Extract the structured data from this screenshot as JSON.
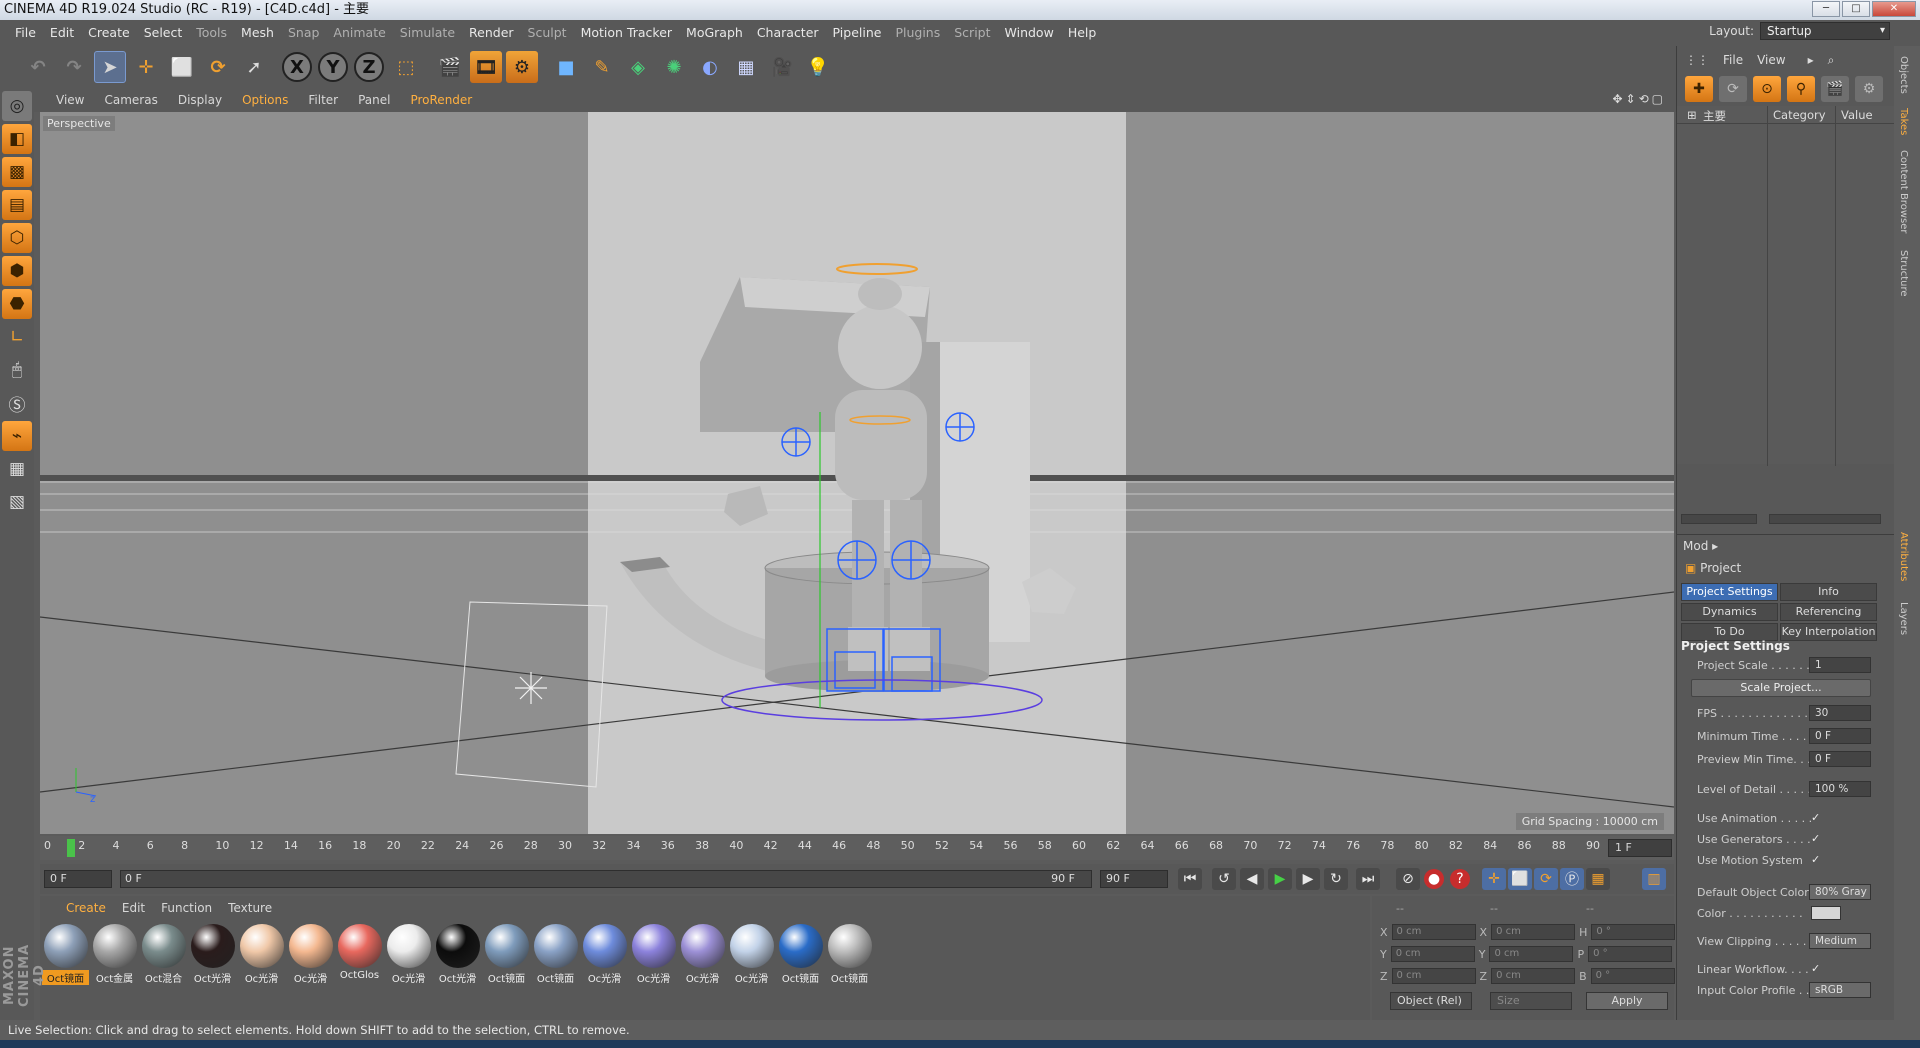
{
  "window": {
    "title": "CINEMA 4D R19.024 Studio (RC - R19) - [C4D.c4d] - 主要"
  },
  "menubar": [
    "File",
    "Edit",
    "Create",
    "Select",
    "Tools",
    "Mesh",
    "Snap",
    "Animate",
    "Simulate",
    "Render",
    "Sculpt",
    "Motion Tracker",
    "MoGraph",
    "Character",
    "Pipeline",
    "Plugins",
    "Script",
    "Window",
    "Help"
  ],
  "layout": {
    "label": "Layout:",
    "value": "Startup"
  },
  "viewport": {
    "menu": [
      "View",
      "Cameras",
      "Display",
      "Options",
      "Filter",
      "Panel",
      "ProRender"
    ],
    "camera_label": "Perspective",
    "grid_spacing": "Grid Spacing : 10000 cm"
  },
  "timeline": {
    "ticks": [
      "0",
      "2",
      "4",
      "6",
      "8",
      "10",
      "12",
      "14",
      "16",
      "18",
      "20",
      "22",
      "24",
      "26",
      "28",
      "30",
      "32",
      "34",
      "36",
      "38",
      "40",
      "42",
      "44",
      "46",
      "48",
      "50",
      "52",
      "54",
      "56",
      "58",
      "60",
      "62",
      "64",
      "66",
      "68",
      "70",
      "72",
      "74",
      "76",
      "78",
      "80",
      "82",
      "84",
      "86",
      "88",
      "90"
    ],
    "current_frame": "1 F",
    "start": "0 F",
    "range_start": "0 F",
    "range_end": "90 F",
    "end": "90 F"
  },
  "material_manager": {
    "menu": [
      "Create",
      "Edit",
      "Function",
      "Texture"
    ],
    "materials": [
      {
        "label": "Oct镜面",
        "color": "#8ea0b8"
      },
      {
        "label": "Oct金属",
        "color": "#a8a8a8"
      },
      {
        "label": "Oct混合",
        "color": "#7a8c8c"
      },
      {
        "label": "Oct光滑",
        "color": "#2a1c1c"
      },
      {
        "label": "Oc光滑",
        "color": "#f0c8a8"
      },
      {
        "label": "Oc光滑",
        "color": "#f4b890"
      },
      {
        "label": "OctGlos",
        "color": "#e8685e"
      },
      {
        "label": "Oc光滑",
        "color": "#ececec"
      },
      {
        "label": "Oct光滑",
        "color": "#0c0c0c"
      },
      {
        "label": "Oct镜面",
        "color": "#7f9cbc"
      },
      {
        "label": "Oct镜面",
        "color": "#8aa2c6"
      },
      {
        "label": "Oc光滑",
        "color": "#6e8cdc"
      },
      {
        "label": "Oc光滑",
        "color": "#8c82dc"
      },
      {
        "label": "Oc光滑",
        "color": "#9c90d6"
      },
      {
        "label": "Oc光滑",
        "color": "#c2d2e8"
      },
      {
        "label": "Oct镜面",
        "color": "#2a6cc8"
      },
      {
        "label": "Oct镜面",
        "color": "#bdbdbd"
      }
    ]
  },
  "coordinates": {
    "headers": [
      "--",
      "--",
      "--"
    ],
    "rows": [
      {
        "a": "X",
        "av": "0 cm",
        "b": "X",
        "bv": "0 cm",
        "c": "H",
        "cv": "0 °"
      },
      {
        "a": "Y",
        "av": "0 cm",
        "b": "Y",
        "bv": "0 cm",
        "c": "P",
        "cv": "0 °"
      },
      {
        "a": "Z",
        "av": "0 cm",
        "b": "Z",
        "bv": "0 cm",
        "c": "B",
        "cv": "0 °"
      }
    ],
    "mode": "Object (Rel)",
    "size": "Size",
    "apply": "Apply"
  },
  "objects_panel": {
    "menu": [
      "File",
      "View"
    ],
    "root_item": "主要",
    "col_category": "Category",
    "col_value": "Value"
  },
  "attributes": {
    "mode_label": "Mod",
    "object_name": "Project",
    "tabs": [
      "Project Settings",
      "Info",
      "Dynamics",
      "Referencing",
      "To Do",
      "Key Interpolation"
    ],
    "section": "Project Settings",
    "project_scale_label": "Project Scale . . . . . .",
    "project_scale": "1",
    "scale_button": "Scale Project...",
    "fps_label": "FPS . . . . . . . . . . . . . .",
    "fps": "30",
    "min_time_label": "Minimum Time . . . . .",
    "min_time": "0 F",
    "preview_min_label": "Preview Min Time. . .",
    "preview_min": "0 F",
    "lod_label": "Level of Detail . . . . .",
    "lod": "100 %",
    "use_animation": "Use Animation . . . . .",
    "use_generators": "Use Generators . . . .",
    "use_motion": "Use Motion System",
    "default_color_label": "Default Object Color",
    "default_color": "80% Gray",
    "color_label": "Color . . . . . . . . . . .",
    "view_clipping_label": "View Clipping . . . . .",
    "view_clipping": "Medium",
    "linear_workflow": "Linear Workflow. . . .",
    "input_profile_label": "Input Color Profile . .",
    "input_profile": "sRGB",
    "check": "✓"
  },
  "side_tabs": [
    "Objects",
    "Takes",
    "Content Browser",
    "Structure",
    "Attributes",
    "Layers"
  ],
  "status": "Live Selection: Click and drag to select elements. Hold down SHIFT to add to the selection, CTRL to remove.",
  "brand": "MAXON CINEMA 4D"
}
